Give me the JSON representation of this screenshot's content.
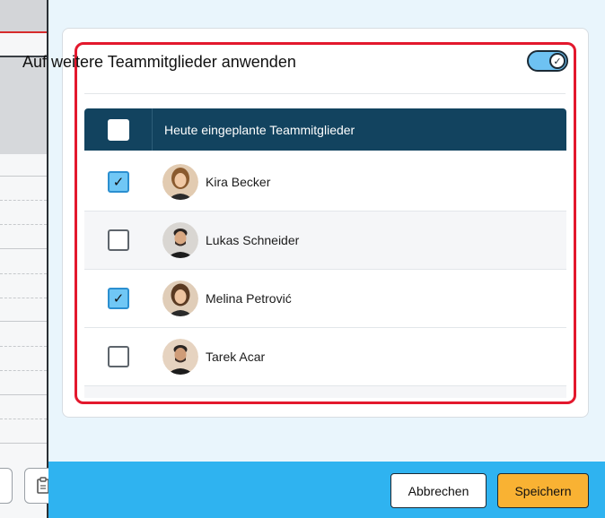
{
  "panel": {
    "title": "Auf weitere Teammitglieder anwenden",
    "toggle_on": true
  },
  "table": {
    "header_label": "Heute eingeplante Teammitglieder",
    "select_all_checked": false,
    "rows": [
      {
        "name": "Kira Becker",
        "checked": true,
        "avatar": "woman-avatar"
      },
      {
        "name": "Lukas Schneider",
        "checked": false,
        "avatar": "man-avatar"
      },
      {
        "name": "Melina Petrović",
        "checked": true,
        "avatar": "woman-avatar"
      },
      {
        "name": "Tarek Acar",
        "checked": false,
        "avatar": "man-avatar"
      }
    ]
  },
  "footer": {
    "cancel_label": "Abbrechen",
    "save_label": "Speichern"
  },
  "colors": {
    "highlight": "#e3182d",
    "header_bg": "#12435f",
    "checkbox_checked": "#70c7f5",
    "footer_bg": "#2fb3f0",
    "save_button": "#f9b233"
  }
}
